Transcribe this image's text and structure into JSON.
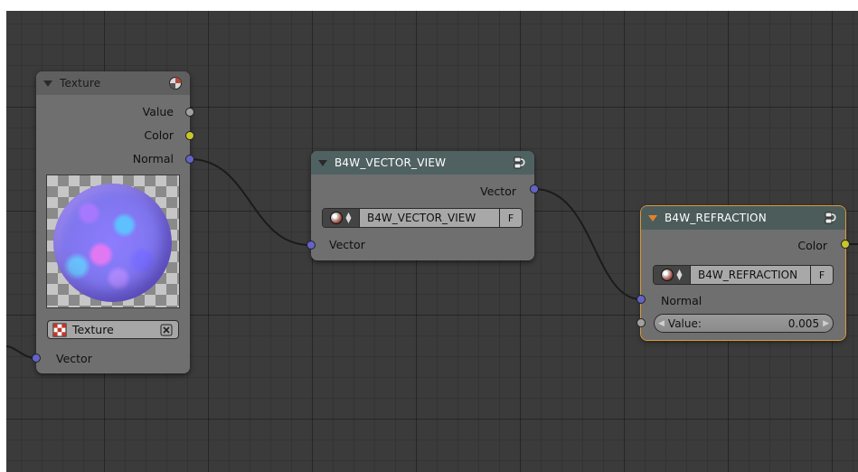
{
  "texture_node": {
    "title": "Texture",
    "outputs": [
      "Value",
      "Color",
      "Normal"
    ],
    "texture_field": "Texture",
    "input": "Vector"
  },
  "vector_view_node": {
    "title": "B4W_VECTOR_VIEW",
    "output": "Vector",
    "group_name": "B4W_VECTOR_VIEW",
    "fake_user": "F",
    "input": "Vector"
  },
  "refraction_node": {
    "title": "B4W_REFRACTION",
    "output": "Color",
    "group_name": "B4W_REFRACTION",
    "fake_user": "F",
    "input_normal": "Normal",
    "value_label": "Value:",
    "value": "0.005"
  },
  "colors": {
    "background": "#3b3b3b",
    "node_body": "#6f6f6f",
    "selected_outline": "#d99a3a",
    "socket_vector": "#6363c7",
    "socket_color": "#c7c729",
    "socket_value": "#a1a1a1"
  },
  "icons": [
    "collapse-arrow-icon",
    "texture-icon",
    "node-group-icon",
    "material-sphere-icon",
    "texture-checker-icon",
    "unlink-x-icon"
  ]
}
